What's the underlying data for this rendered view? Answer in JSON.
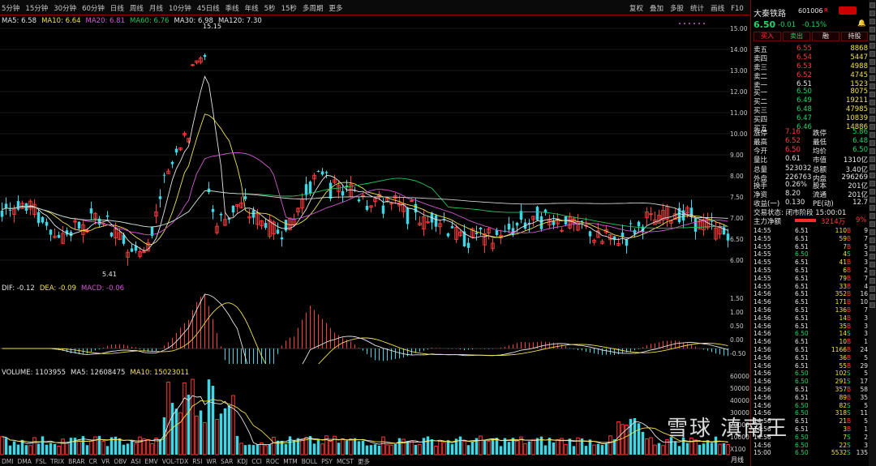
{
  "toolbar": {
    "periods": [
      "5分钟",
      "15分钟",
      "30分钟",
      "60分钟",
      "日线",
      "周线",
      "月线",
      "10分钟",
      "45日线",
      "季线",
      "年线",
      "5秒",
      "15秒",
      "多周期",
      "更多"
    ],
    "tools": [
      "复权",
      "叠加",
      "多股",
      "统计",
      "画线",
      "F10",
      "标记",
      "返回"
    ]
  },
  "kline": {
    "ma_legend": [
      {
        "label": "MA5: 6.58",
        "color": "#e6e6e6"
      },
      {
        "label": "MA10: 6.64",
        "color": "#f2e14c"
      },
      {
        "label": "MA20: 6.81",
        "color": "#d25bd2"
      },
      {
        "label": "MA60: 6.76",
        "color": "#22c55e"
      },
      {
        "label": "MA30: 6.98",
        "color": "#e6e6e6"
      },
      {
        "label": "MA120: 7.30",
        "color": "#e6e6e6"
      }
    ],
    "high_label": "15.15",
    "low_label": "5.41",
    "y_ticks": [
      "15.00",
      "14.00",
      "13.00",
      "12.00",
      "11.00",
      "10.00",
      "9.00",
      "8.00",
      "7.50",
      "7.00",
      "6.50",
      "6.00"
    ]
  },
  "macd": {
    "legend": [
      {
        "label": "DIF: -0.12",
        "color": "#e6e6e6"
      },
      {
        "label": "DEA: -0.09",
        "color": "#f2e14c"
      },
      {
        "label": "MACD: -0.06",
        "color": "#d25bd2"
      }
    ],
    "y_ticks": [
      "1.50",
      "1.00",
      "0.50",
      "0.00",
      "-0.50"
    ]
  },
  "volume": {
    "legend": [
      {
        "label": "VOLUME: 1103955",
        "color": "#e6e6e6"
      },
      {
        "label": "MA5: 12608475",
        "color": "#e6e6e6"
      },
      {
        "label": "MA10: 15023011",
        "color": "#f2e14c"
      }
    ],
    "y_ticks": [
      "60000",
      "50000",
      "40000",
      "30000",
      "20000",
      "10000",
      "X100"
    ]
  },
  "quote": {
    "name": "大秦铁路",
    "code": "601006",
    "tag": "R",
    "price": "6.50",
    "change": "-0.01",
    "change_pct": "-0.15%",
    "buttons": [
      "买入",
      "卖出",
      "融",
      "持股"
    ],
    "asks": [
      {
        "label": "卖五",
        "price": "6.55",
        "vol": "8868"
      },
      {
        "label": "卖四",
        "price": "6.54",
        "vol": "5447"
      },
      {
        "label": "卖三",
        "price": "6.53",
        "vol": "4988"
      },
      {
        "label": "卖二",
        "price": "6.52",
        "vol": "4745"
      },
      {
        "label": "卖一",
        "price": "6.51",
        "vol": "1523"
      }
    ],
    "bids": [
      {
        "label": "买一",
        "price": "6.50",
        "vol": "8075"
      },
      {
        "label": "买二",
        "price": "6.49",
        "vol": "19211"
      },
      {
        "label": "买三",
        "price": "6.48",
        "vol": "47985"
      },
      {
        "label": "买四",
        "price": "6.47",
        "vol": "10839"
      },
      {
        "label": "买五",
        "price": "6.46",
        "vol": "14886"
      }
    ],
    "stats": [
      {
        "l1": "涨停",
        "v1": "7.16",
        "l2": "跌停",
        "v2": "5.86"
      },
      {
        "l1": "最高",
        "v1": "6.52",
        "l2": "最低",
        "v2": "6.48"
      },
      {
        "l1": "今开",
        "v1": "6.50",
        "l2": "均价",
        "v2": "6.50"
      },
      {
        "l1": "量比",
        "v1": "0.61",
        "l2": "市值",
        "v2": "1310亿"
      },
      {
        "l1": "总量",
        "v1": "523032",
        "l2": "总额",
        "v2": "3.40亿"
      },
      {
        "l1": "外盘",
        "v1": "226763",
        "l2": "内盘",
        "v2": "296269"
      },
      {
        "l1": "换手",
        "v1": "0.26%",
        "l2": "股本",
        "v2": "201亿"
      },
      {
        "l1": "净资",
        "v1": "8.20",
        "l2": "流通",
        "v2": "201亿"
      },
      {
        "l1": "收益(一)",
        "v1": "0.130",
        "l2": "PE(动)",
        "v2": "12.7"
      }
    ],
    "status": "交易状态: 闭市阶段 15:00:01",
    "net_label": "主力净额",
    "net_value": "3214万",
    "net_pct": "9%"
  },
  "trades": [
    {
      "t": "14:55",
      "p": "6.51",
      "v": "110",
      "s": "B",
      "n": "9"
    },
    {
      "t": "14:55",
      "p": "6.51",
      "v": "59",
      "s": "B",
      "n": "7"
    },
    {
      "t": "14:55",
      "p": "6.51",
      "v": "7",
      "s": "B",
      "n": "5"
    },
    {
      "t": "14:55",
      "p": "6.50",
      "v": "4",
      "s": "S",
      "n": "3"
    },
    {
      "t": "14:55",
      "p": "6.51",
      "v": "41",
      "s": "B",
      "n": "3"
    },
    {
      "t": "14:55",
      "p": "6.51",
      "v": "6",
      "s": "B",
      "n": "2"
    },
    {
      "t": "14:55",
      "p": "6.51",
      "v": "79",
      "s": "B",
      "n": "7"
    },
    {
      "t": "14:55",
      "p": "6.51",
      "v": "33",
      "s": "B",
      "n": "4"
    },
    {
      "t": "14:56",
      "p": "6.51",
      "v": "352",
      "s": "B",
      "n": "16"
    },
    {
      "t": "14:56",
      "p": "6.51",
      "v": "171",
      "s": "B",
      "n": "10"
    },
    {
      "t": "14:56",
      "p": "6.51",
      "v": "136",
      "s": "B",
      "n": "7"
    },
    {
      "t": "14:56",
      "p": "6.51",
      "v": "14",
      "s": "B",
      "n": "3"
    },
    {
      "t": "14:56",
      "p": "6.51",
      "v": "35",
      "s": "B",
      "n": "3"
    },
    {
      "t": "14:56",
      "p": "6.50",
      "v": "14",
      "s": "S",
      "n": "3"
    },
    {
      "t": "14:56",
      "p": "6.51",
      "v": "10",
      "s": "B",
      "n": "1"
    },
    {
      "t": "14:56",
      "p": "6.51",
      "v": "1166",
      "s": "B",
      "n": "24"
    },
    {
      "t": "14:56",
      "p": "6.51",
      "v": "36",
      "s": "B",
      "n": "5"
    },
    {
      "t": "14:56",
      "p": "6.51",
      "v": "55",
      "s": "B",
      "n": "29"
    },
    {
      "t": "14:56",
      "p": "6.50",
      "v": "102",
      "s": "S",
      "n": "5"
    },
    {
      "t": "14:56",
      "p": "6.50",
      "v": "291",
      "s": "S",
      "n": "17"
    },
    {
      "t": "14:56",
      "p": "6.51",
      "v": "357",
      "s": "B",
      "n": "58"
    },
    {
      "t": "14:56",
      "p": "6.51",
      "v": "89",
      "s": "B",
      "n": "35"
    },
    {
      "t": "14:56",
      "p": "6.50",
      "v": "82",
      "s": "S",
      "n": "5"
    },
    {
      "t": "14:56",
      "p": "6.50",
      "v": "318",
      "s": "S",
      "n": "11"
    },
    {
      "t": "14:56",
      "p": "6.51",
      "v": "21",
      "s": "B",
      "n": "5"
    },
    {
      "t": "14:56",
      "p": "6.51",
      "v": "3",
      "s": "B",
      "n": "1"
    },
    {
      "t": "14:56",
      "p": "6.50",
      "v": "7",
      "s": "S",
      "n": "2"
    },
    {
      "t": "14:56",
      "p": "6.50",
      "v": "22",
      "s": "S",
      "n": "3"
    },
    {
      "t": "15:00",
      "p": "6.50",
      "v": "5532",
      "s": "S",
      "n": "135"
    }
  ],
  "indicators": [
    "DMI",
    "DMA",
    "FSL",
    "TRIX",
    "BRAR",
    "CR",
    "VR",
    "OBV",
    "ASI",
    "EMV",
    "VOL-TDX",
    "RSI",
    "WR",
    "SAR",
    "KDJ",
    "CCI",
    "ROC",
    "MTM",
    "BOLL",
    "PSY",
    "MCST",
    "更多"
  ],
  "footer": {
    "tab": "月线",
    "label": "15:00"
  },
  "watermark": "雪球 滇南王"
}
